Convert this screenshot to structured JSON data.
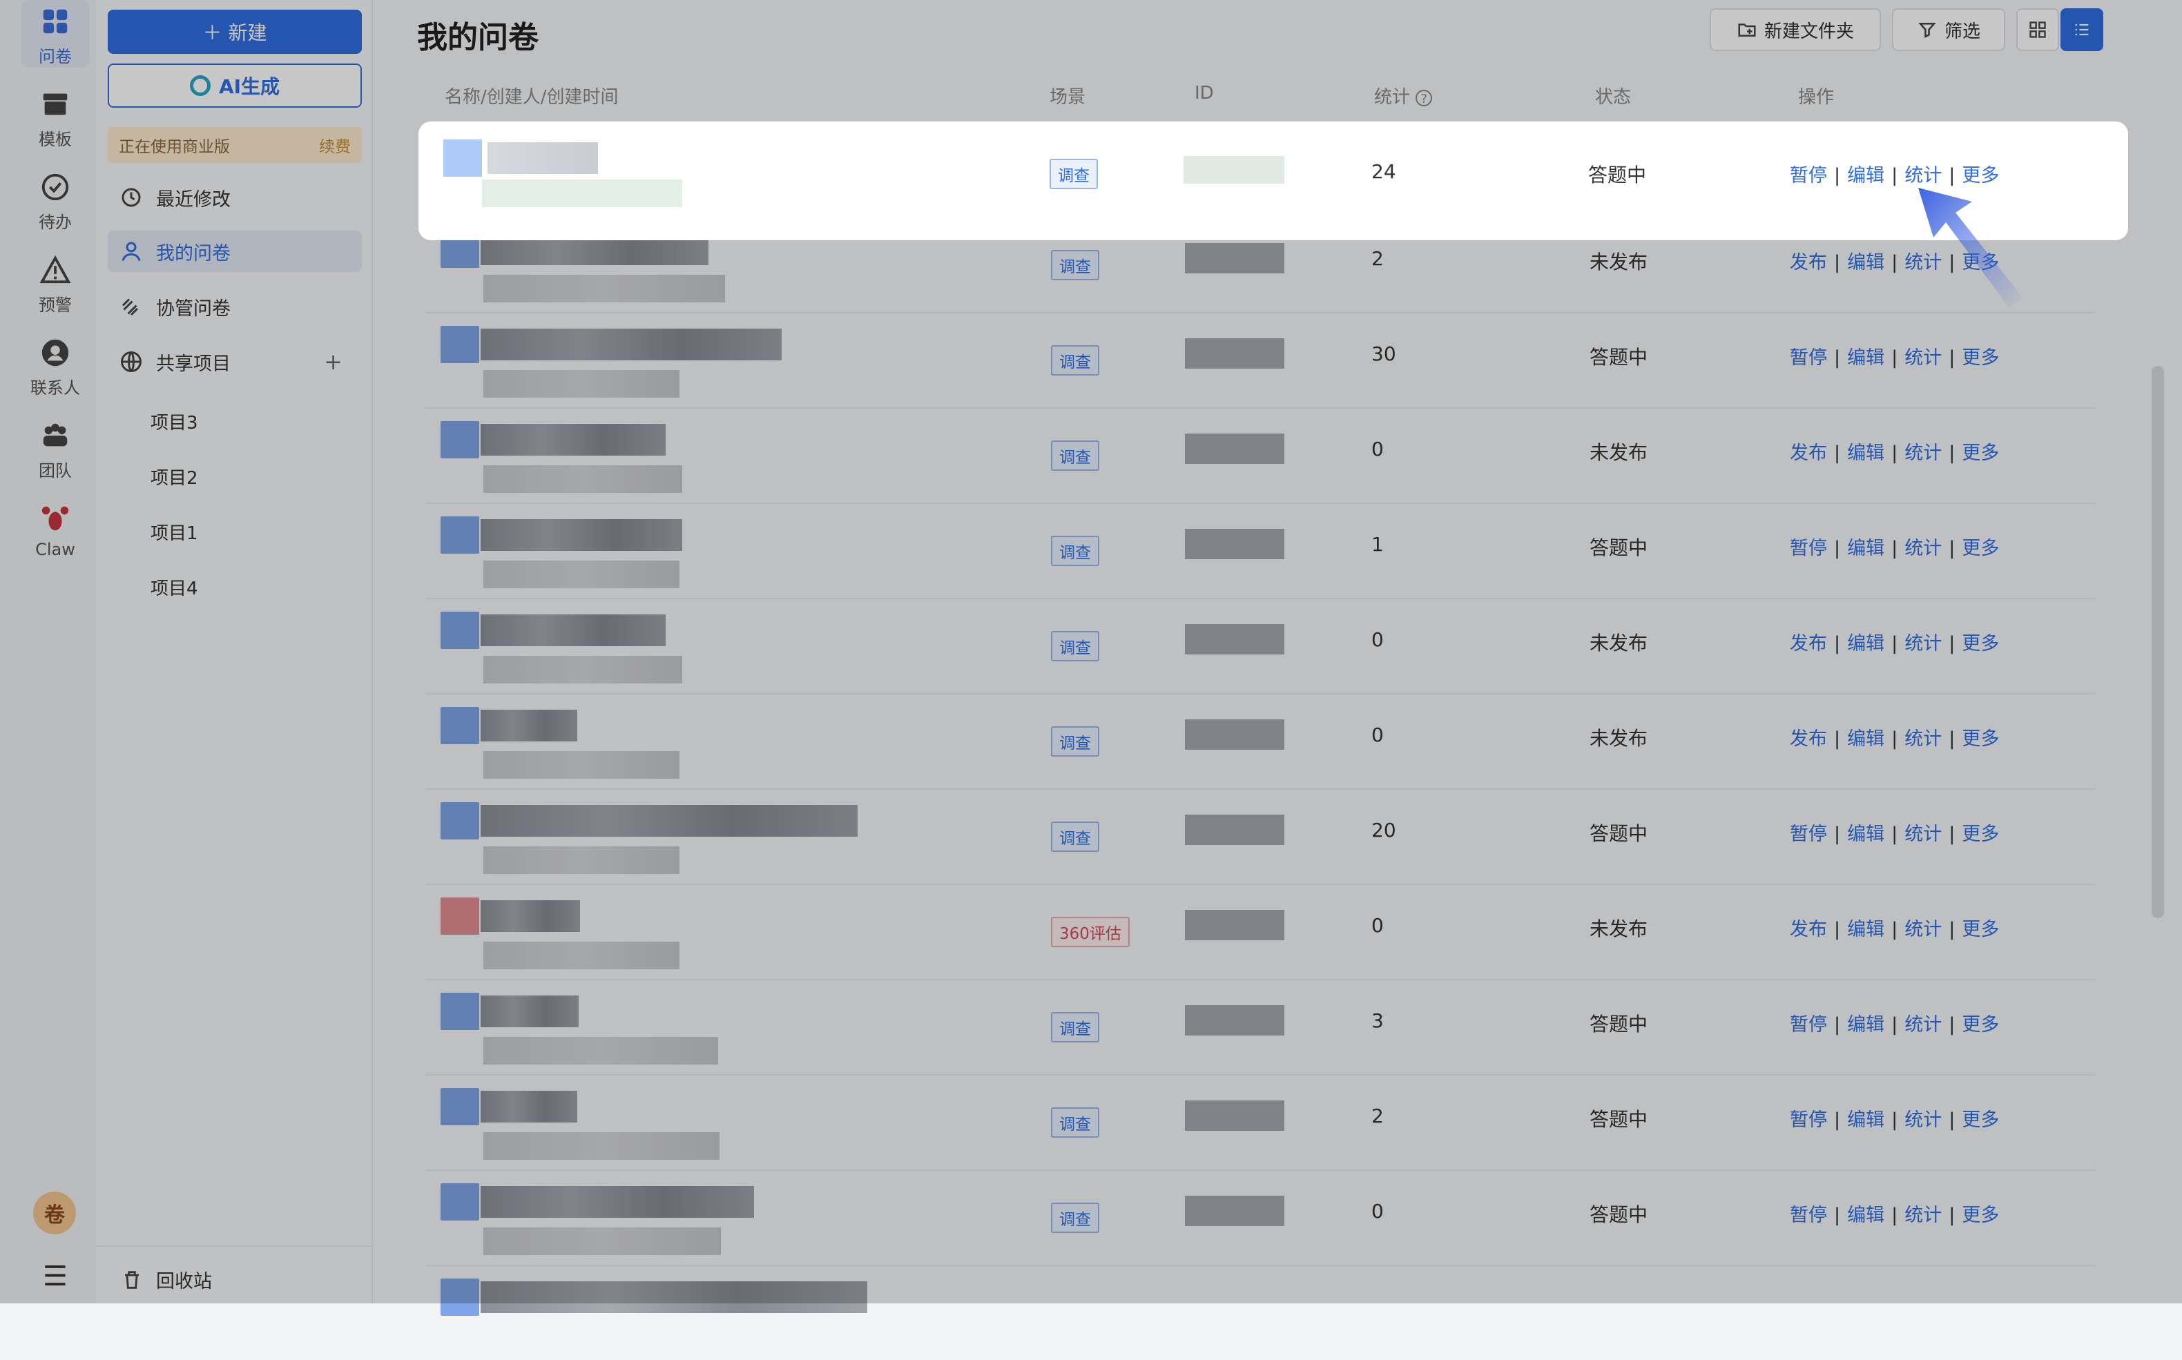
{
  "rail": {
    "items": [
      {
        "label": "问卷",
        "icon": "grid-icon",
        "active": true
      },
      {
        "label": "模板",
        "icon": "archive-icon"
      },
      {
        "label": "待办",
        "icon": "check-circle-icon"
      },
      {
        "label": "预警",
        "icon": "warning-icon"
      },
      {
        "label": "联系人",
        "icon": "person-icon"
      },
      {
        "label": "团队",
        "icon": "team-icon"
      },
      {
        "label": "Claw",
        "icon": "lobster-icon"
      }
    ],
    "avatar": "卷",
    "menu_icon": "hamburger-icon"
  },
  "sidebar": {
    "new_button": "＋ 新建",
    "ai_button": "AI生成",
    "biz_text": "正在使用商业版",
    "renew": "续费",
    "nav": [
      {
        "label": "最近修改",
        "icon": "history-icon"
      },
      {
        "label": "我的问卷",
        "icon": "user-icon",
        "active": true
      },
      {
        "label": "协管问卷",
        "icon": "link-icon"
      },
      {
        "label": "共享项目",
        "icon": "globe-icon"
      }
    ],
    "projects": [
      "项目3",
      "项目2",
      "项目1",
      "项目4"
    ],
    "recycle": "回收站"
  },
  "header": {
    "title": "我的问卷",
    "new_folder": "新建文件夹",
    "filter": "筛选"
  },
  "columns": {
    "name": "名称/创建人/创建时间",
    "scene": "场景",
    "id": "ID",
    "stat": "统计",
    "state": "状态",
    "ops": "操作"
  },
  "rows": [
    {
      "scene": "调查",
      "stat": "24",
      "state": "答题中",
      "op1": "暂停",
      "op2": "编辑",
      "op3": "统计",
      "op4": "更多"
    },
    {
      "scene": "调查",
      "stat": "2",
      "state": "未发布",
      "op1": "发布",
      "op2": "编辑",
      "op3": "统计",
      "op4": "更多"
    },
    {
      "scene": "调查",
      "stat": "30",
      "state": "答题中",
      "op1": "暂停",
      "op2": "编辑",
      "op3": "统计",
      "op4": "更多"
    },
    {
      "scene": "调查",
      "stat": "0",
      "state": "未发布",
      "op1": "发布",
      "op2": "编辑",
      "op3": "统计",
      "op4": "更多"
    },
    {
      "scene": "调查",
      "stat": "1",
      "state": "答题中",
      "op1": "暂停",
      "op2": "编辑",
      "op3": "统计",
      "op4": "更多"
    },
    {
      "scene": "调查",
      "stat": "0",
      "state": "未发布",
      "op1": "发布",
      "op2": "编辑",
      "op3": "统计",
      "op4": "更多"
    },
    {
      "scene": "调查",
      "stat": "0",
      "state": "未发布",
      "op1": "发布",
      "op2": "编辑",
      "op3": "统计",
      "op4": "更多"
    },
    {
      "scene": "调查",
      "stat": "20",
      "state": "答题中",
      "op1": "暂停",
      "op2": "编辑",
      "op3": "统计",
      "op4": "更多"
    },
    {
      "scene": "360评估",
      "stat": "0",
      "state": "未发布",
      "op1": "发布",
      "op2": "编辑",
      "op3": "统计",
      "op4": "更多"
    },
    {
      "scene": "调查",
      "stat": "3",
      "state": "答题中",
      "op1": "暂停",
      "op2": "编辑",
      "op3": "统计",
      "op4": "更多"
    },
    {
      "scene": "调查",
      "stat": "2",
      "state": "答题中",
      "op1": "暂停",
      "op2": "编辑",
      "op3": "统计",
      "op4": "更多"
    },
    {
      "scene": "调查",
      "stat": "0",
      "state": "答题中",
      "op1": "暂停",
      "op2": "编辑",
      "op3": "统计",
      "op4": "更多"
    }
  ],
  "colors": {
    "accent": "#2f6de0",
    "warn_tag": "#d34d5a"
  }
}
